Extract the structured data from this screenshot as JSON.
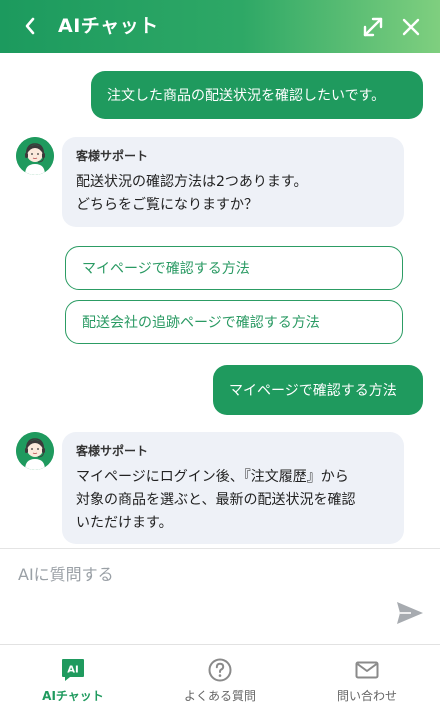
{
  "header": {
    "title": "AIチャット",
    "back_icon": "chevron-left-icon",
    "expand_icon": "expand-icon",
    "close_icon": "close-icon",
    "gradient_start": "#1c9a5e",
    "gradient_end": "#7fcf7f"
  },
  "messages": {
    "user1": "注文した商品の配送状況を確認したいです。",
    "bot1_name": "客様サポート",
    "bot1_text": "配送状況の確認方法は2つあります。\nどちらをご覧になりますか？",
    "option1": "マイページで確認する方法",
    "option2": "配送会社の追跡ページで確認する方法",
    "user2": "マイページで確認する方法",
    "bot2_name": "客様サポート",
    "bot2_text": "マイページにログイン後、『注文履歴』から\n対象の商品を選ぶと、最新の配送状況を確認\nいただけます。"
  },
  "input": {
    "placeholder": "AIに質問する",
    "value": "",
    "send_icon": "send-icon"
  },
  "tabs": {
    "ai_chat": {
      "label": "AIチャット",
      "badge": "AI",
      "icon": "ai-chat-icon"
    },
    "faq": {
      "label": "よくある質問",
      "icon": "question-circle-icon"
    },
    "contact": {
      "label": "問い合わせ",
      "icon": "mail-icon"
    }
  },
  "colors": {
    "accent": "#1f9a5e",
    "bot_bubble": "#eef1f7",
    "inactive_tab": "#888888"
  }
}
